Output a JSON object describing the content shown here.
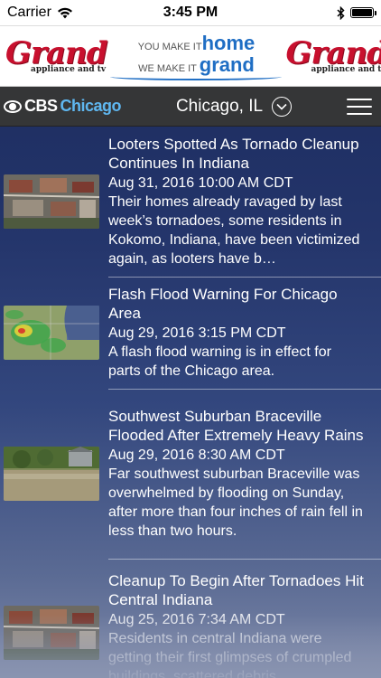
{
  "status_bar": {
    "carrier": "Carrier",
    "time": "3:45 PM",
    "battery_level": 1.0
  },
  "ad": {
    "logo_left": "Grand",
    "logo_left_sub": "appliance and tv",
    "tagline_line1_small": "YOU MAKE IT",
    "tagline_line1_big": "home",
    "tagline_line2_small": "WE MAKE IT",
    "tagline_line2_big": "grand",
    "logo_right": "Grand",
    "logo_right_sub": "appliance and tv",
    "brand_color": "#c8102e",
    "accent_color": "#1f6ec4"
  },
  "nav": {
    "brand": "CBS",
    "brand_city": "Chicago",
    "location": "Chicago, IL",
    "chevron_icon": "chevron-down-circle-icon",
    "menu_icon": "hamburger-menu-icon"
  },
  "articles": [
    {
      "headline": "Looters Spotted As Tornado Cleanup Continues In Indiana",
      "date": "Aug 31, 2016 10:00 AM CDT",
      "summary": "Their homes already ravaged by last week’s tornadoes, some residents in Kokomo, Indiana, have been victimized again, as looters have b…",
      "thumb": "aerial-tornado-damage"
    },
    {
      "headline": "Flash Flood Warning For Chicago Area",
      "date": "Aug 29, 2016 3:15 PM CDT",
      "summary": "A flash flood warning is in effect for parts of the Chicago area.",
      "thumb": "weather-radar-map"
    },
    {
      "headline": "Southwest Suburban Braceville Flooded After Extremely Heavy Rains",
      "date": "Aug 29, 2016 8:30 AM CDT",
      "summary": "Far southwest suburban Braceville was overwhelmed by flooding on Sunday, after more than four inches of rain fell in less than two hours.",
      "thumb": "flooded-street"
    },
    {
      "headline": "Cleanup To Begin After Tornadoes Hit Central Indiana",
      "date": "Aug 25, 2016 7:34 AM CDT",
      "summary": "Residents in central Indiana were getting their first glimpses of crumpled buildings, scattered debris",
      "thumb": "aerial-tornado-damage"
    }
  ]
}
